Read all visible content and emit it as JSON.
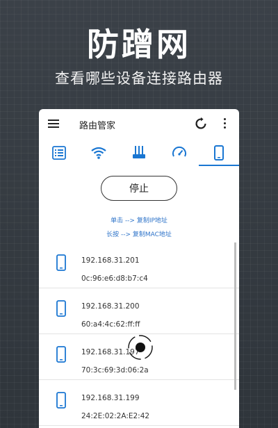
{
  "promo": {
    "title": "防蹭网",
    "subtitle": "查看哪些设备连接路由器"
  },
  "appbar": {
    "title": "路由管家",
    "menu_icon": "menu-icon",
    "refresh_icon": "refresh-icon",
    "more_icon": "more-vert-icon"
  },
  "tabs": [
    {
      "icon": "list-icon"
    },
    {
      "icon": "wifi-icon"
    },
    {
      "icon": "router-icon"
    },
    {
      "icon": "speedometer-icon"
    },
    {
      "icon": "phone-icon",
      "selected": true
    }
  ],
  "accent_color": "#1976d2",
  "stop_label": "停止",
  "hints": {
    "tap": "单击 --> 复制IP地址",
    "long_press": "长按 --> 复制MAC地址"
  },
  "devices": [
    {
      "ip": "192.168.31.201",
      "mac": "0c:96:e6:d8:b7:c4"
    },
    {
      "ip": "192.168.31.200",
      "mac": "60:a4:4c:62:ff:ff"
    },
    {
      "ip": "192.168.31.197",
      "mac": "70:3c:69:3d:06:2a"
    },
    {
      "ip": "192.168.31.199",
      "mac": "24:2E:02:2A:E2:42"
    }
  ]
}
